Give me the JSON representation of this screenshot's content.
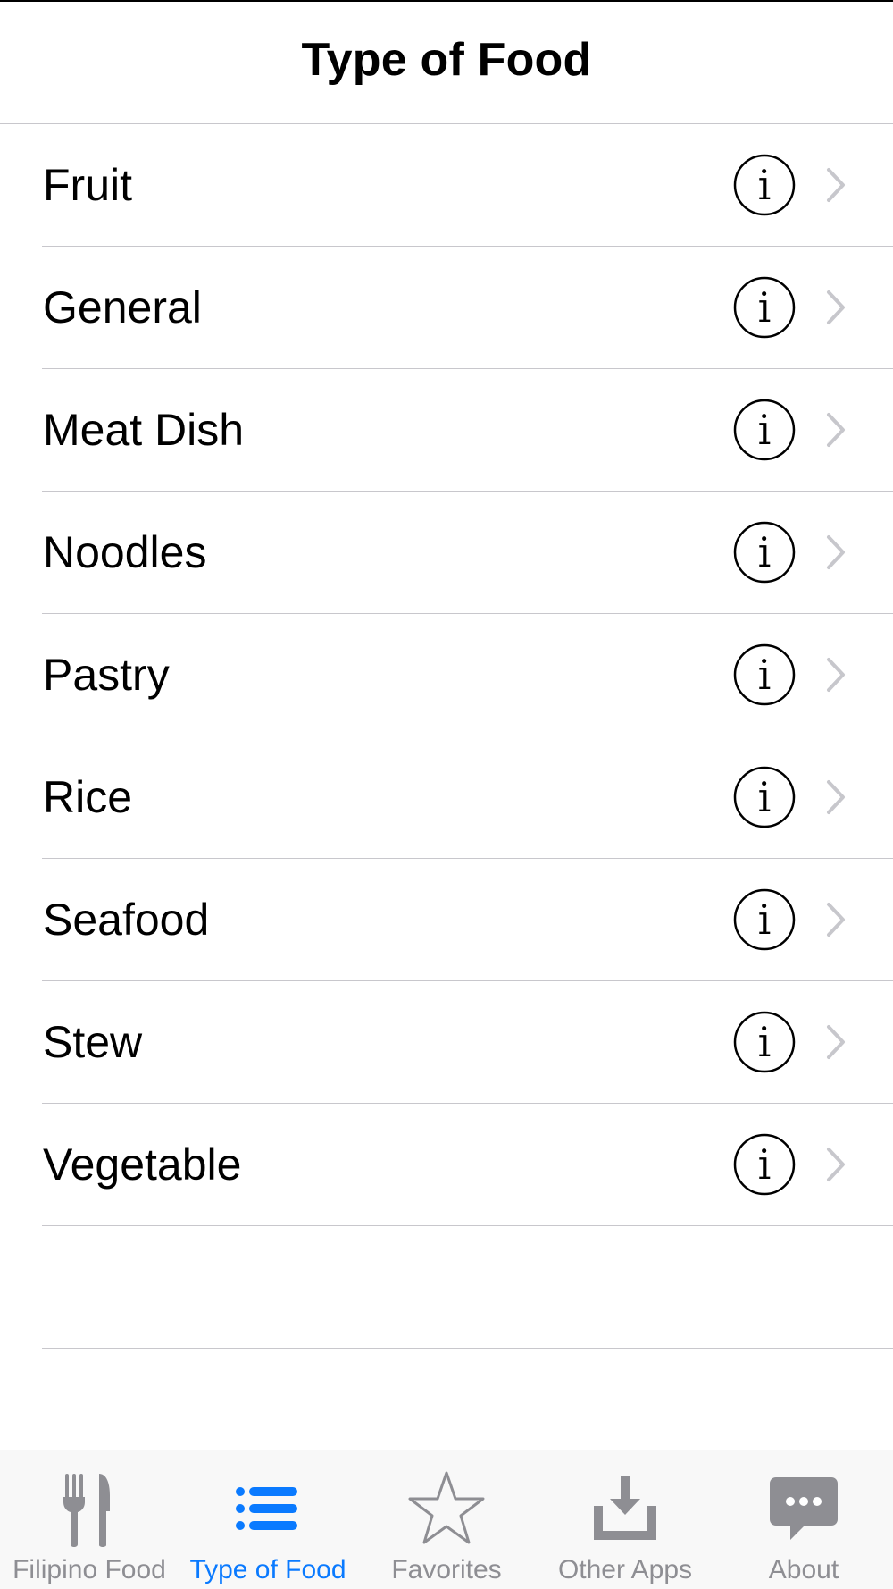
{
  "nav": {
    "title": "Type of Food"
  },
  "list": {
    "items": [
      {
        "label": "Fruit"
      },
      {
        "label": "General"
      },
      {
        "label": "Meat Dish"
      },
      {
        "label": "Noodles"
      },
      {
        "label": "Pastry"
      },
      {
        "label": "Rice"
      },
      {
        "label": "Seafood"
      },
      {
        "label": "Stew"
      },
      {
        "label": "Vegetable"
      }
    ],
    "info_icon": "info-circle-icon",
    "chevron_icon": "chevron-right-icon"
  },
  "tabbar": {
    "active_color": "#0a7aff",
    "inactive_color": "#8e8e93",
    "tabs": [
      {
        "label": "Filipino Food",
        "icon": "fork-knife-icon",
        "active": false
      },
      {
        "label": "Type of Food",
        "icon": "list-icon",
        "active": true
      },
      {
        "label": "Favorites",
        "icon": "star-icon",
        "active": false
      },
      {
        "label": "Other Apps",
        "icon": "download-icon",
        "active": false
      },
      {
        "label": "About",
        "icon": "chat-bubble-icon",
        "active": false
      }
    ]
  }
}
